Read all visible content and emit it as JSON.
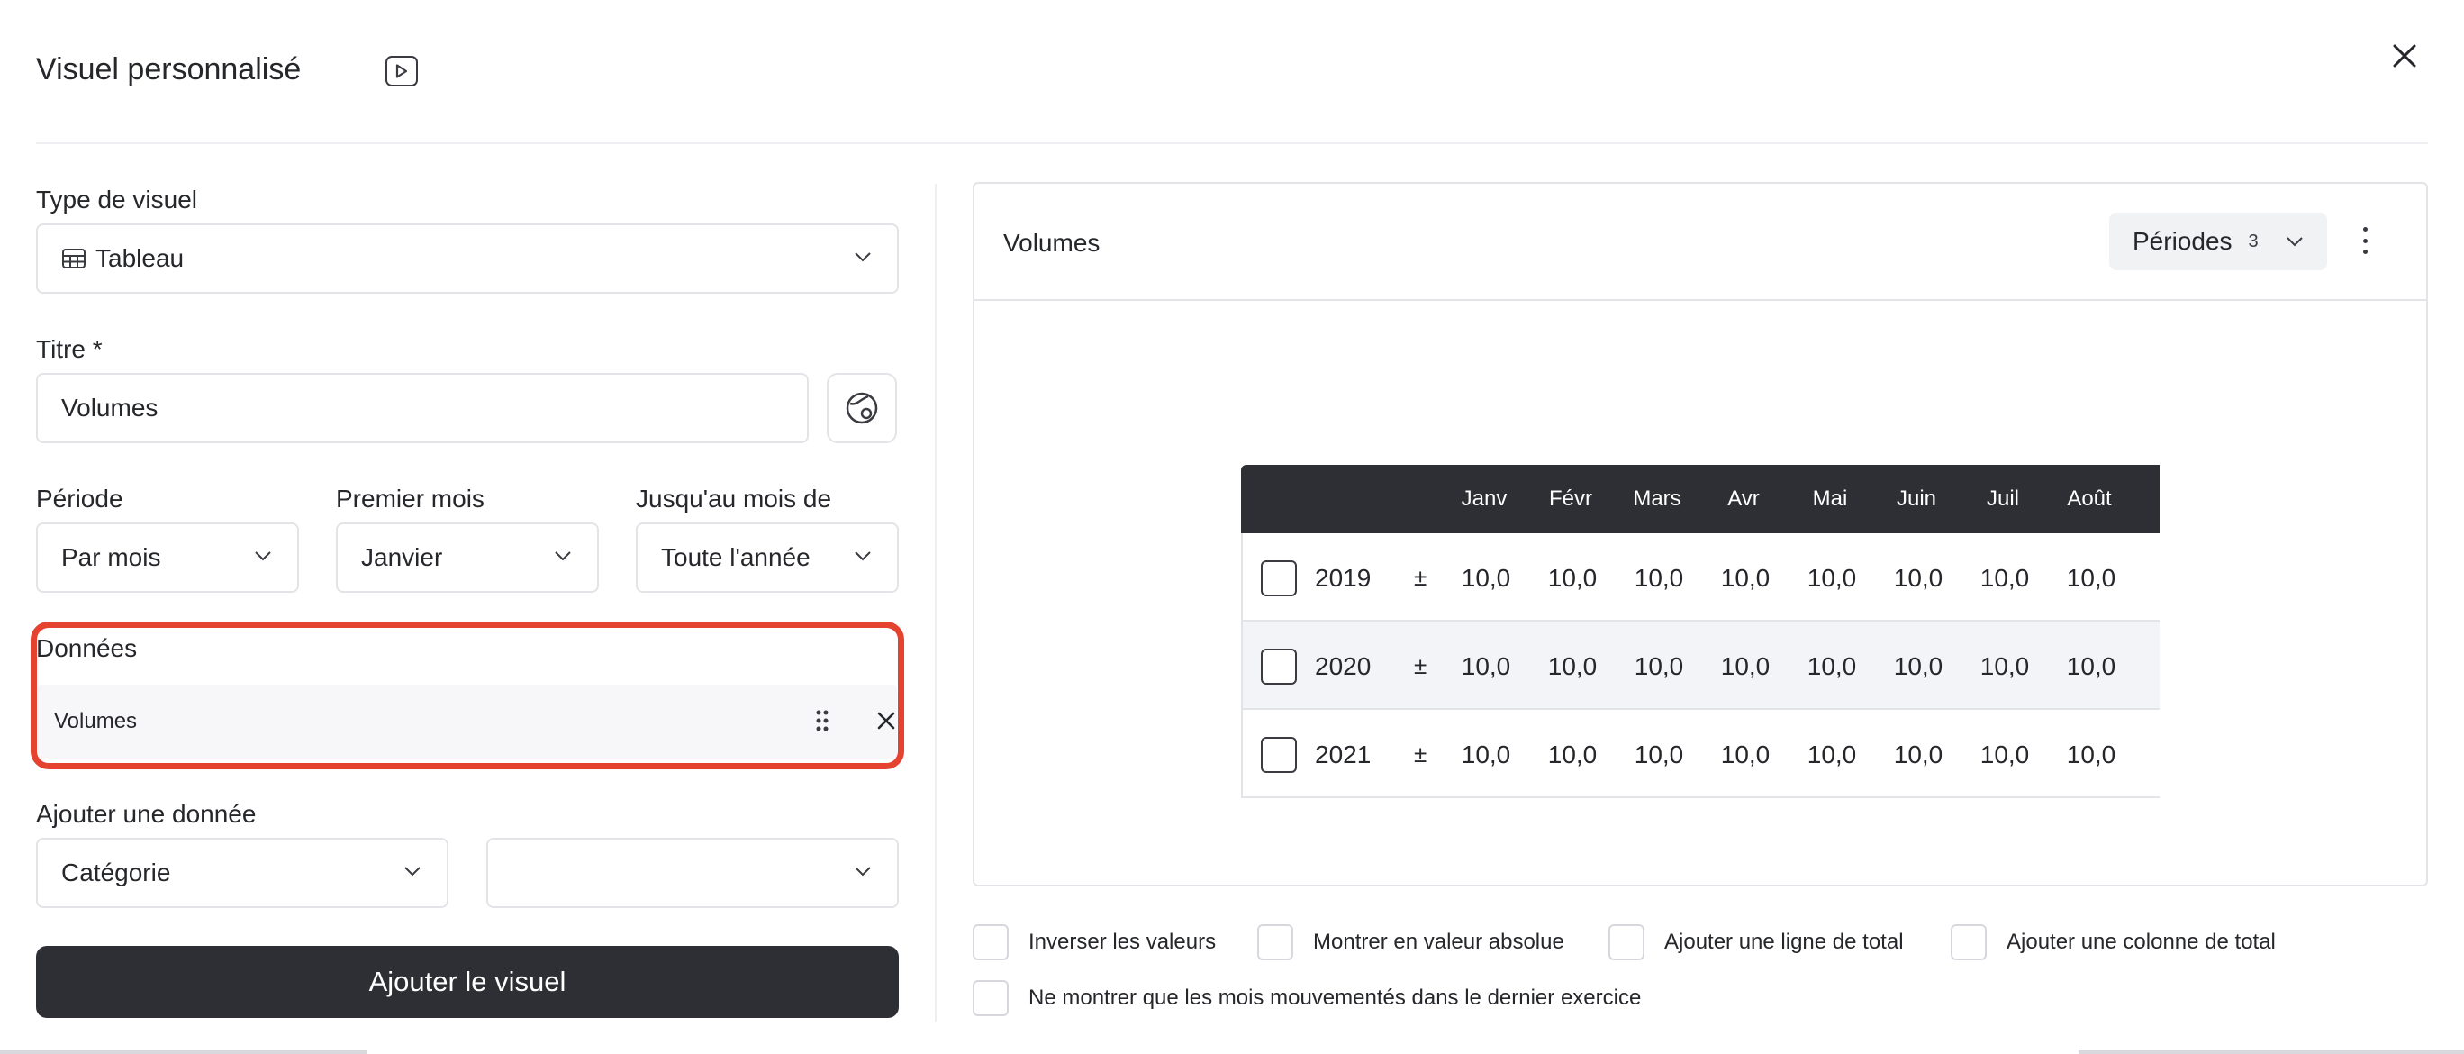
{
  "header": {
    "title": "Visuel personnalisé"
  },
  "form": {
    "type_label": "Type de visuel",
    "type_value": "Tableau",
    "title_label": "Titre *",
    "title_value": "Volumes",
    "periode_label": "Période",
    "periode_value": "Par mois",
    "premier_mois_label": "Premier mois",
    "premier_mois_value": "Janvier",
    "jusquau_label": "Jusqu'au mois de",
    "jusquau_value": "Toute l'année",
    "donnees_label": "Données",
    "donnees_items": [
      "Volumes"
    ],
    "ajouter_label": "Ajouter une donnée",
    "categorie_value": "Catégorie",
    "second_select_value": "",
    "submit_label": "Ajouter le visuel"
  },
  "preview": {
    "title": "Volumes",
    "periodes_label": "Périodes",
    "periodes_count": "3",
    "table": {
      "months": [
        "Janv",
        "Févr",
        "Mars",
        "Avr",
        "Mai",
        "Juin",
        "Juil",
        "Août"
      ],
      "rows": [
        {
          "year": "2019",
          "sign": "±",
          "values": [
            "10,0",
            "10,0",
            "10,0",
            "10,0",
            "10,0",
            "10,0",
            "10,0",
            "10,0"
          ]
        },
        {
          "year": "2020",
          "sign": "±",
          "values": [
            "10,0",
            "10,0",
            "10,0",
            "10,0",
            "10,0",
            "10,0",
            "10,0",
            "10,0"
          ]
        },
        {
          "year": "2021",
          "sign": "±",
          "values": [
            "10,0",
            "10,0",
            "10,0",
            "10,0",
            "10,0",
            "10,0",
            "10,0",
            "10,0"
          ]
        }
      ]
    }
  },
  "options": [
    "Inverser les valeurs",
    "Montrer en valeur absolue",
    "Ajouter une ligne de total",
    "Ajouter une colonne de total",
    "Ne montrer que les mois mouvementés dans le dernier exercice"
  ],
  "colors": {
    "highlight": "#e4432f",
    "primary": "#2e2f34",
    "border": "#e3e4e8"
  }
}
